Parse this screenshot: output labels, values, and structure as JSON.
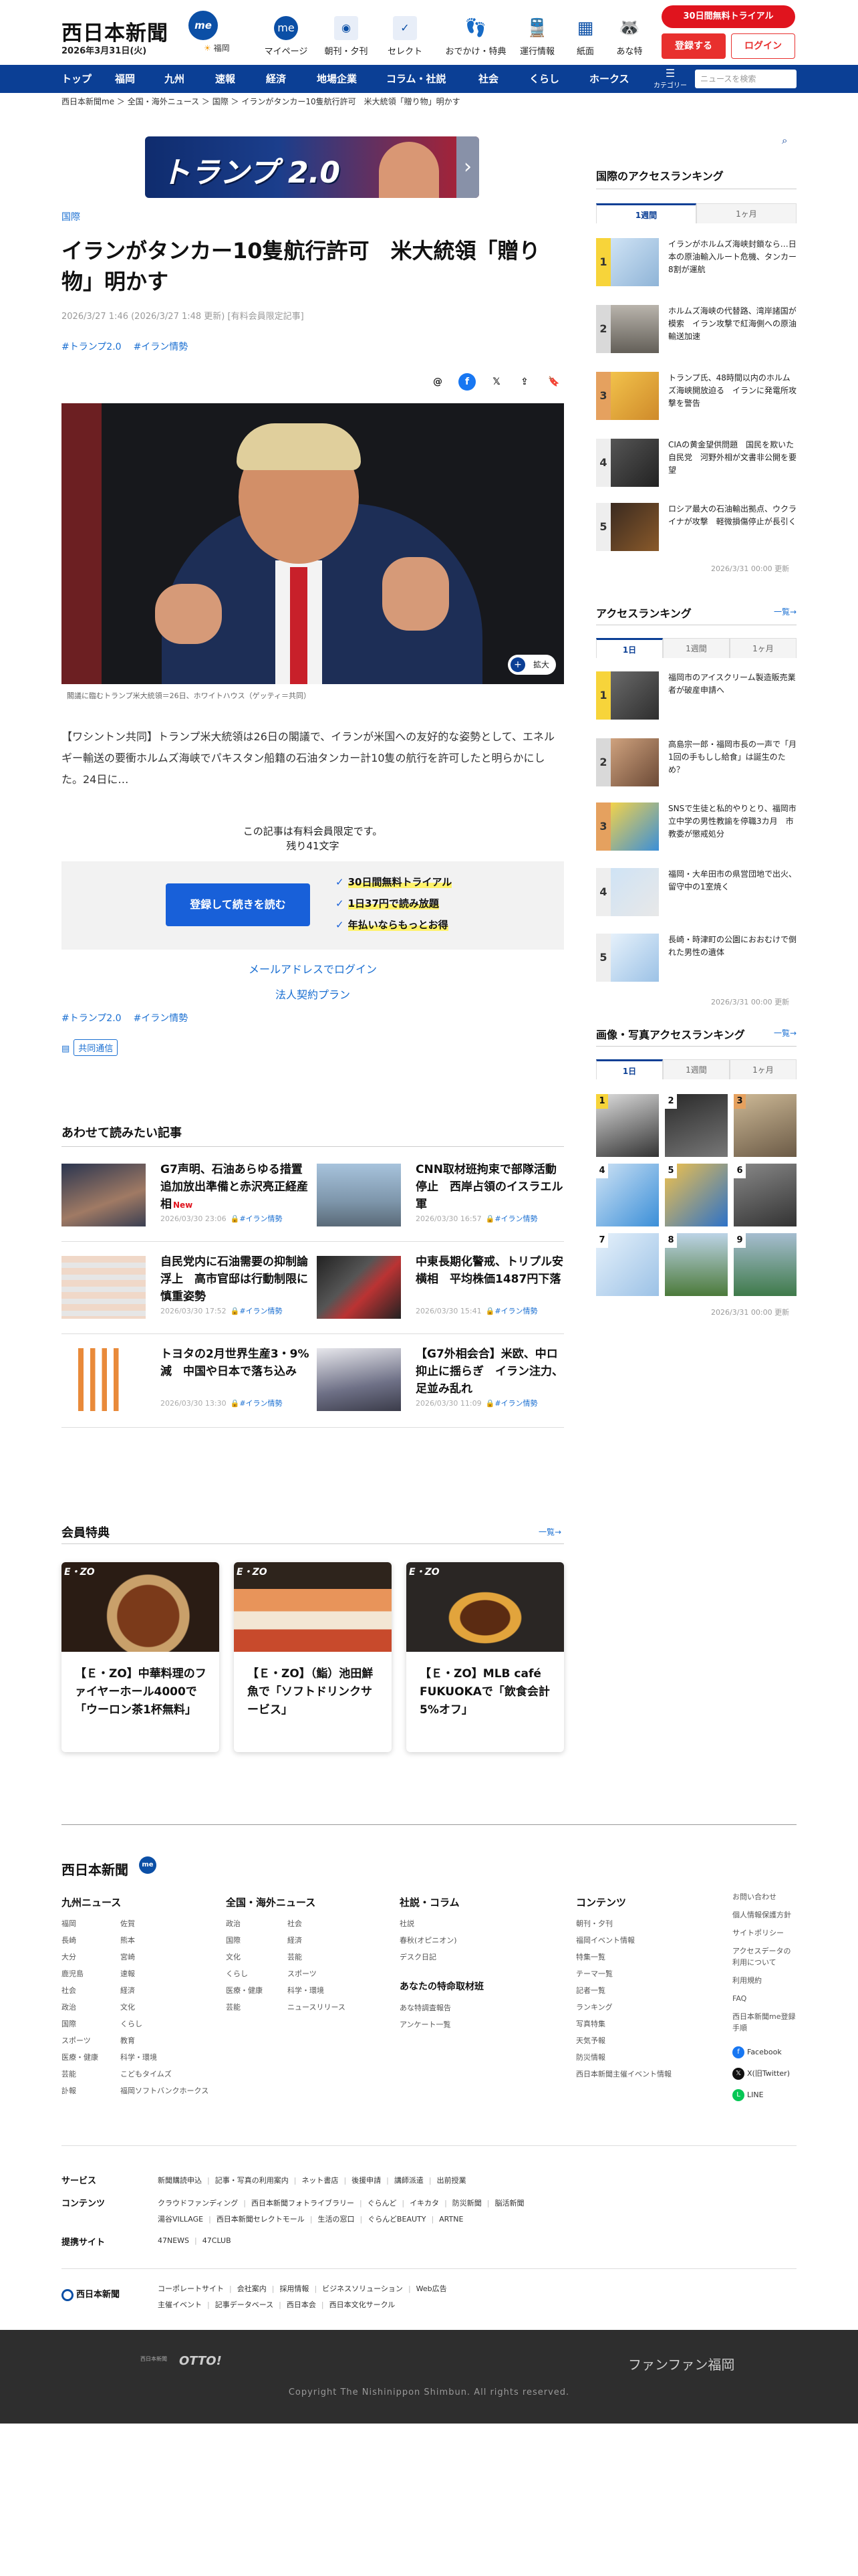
{
  "header": {
    "logo": "西日本新聞",
    "logo_badge": "me",
    "date": "2026年3月31日(火)",
    "weather": "福岡",
    "nav": [
      {
        "label": "マイページ",
        "icon": "mypage-icon",
        "glyph": "me"
      },
      {
        "label": "朝刊・夕刊",
        "icon": "newspaper-icon",
        "glyph": "◉"
      },
      {
        "label": "セレクト",
        "icon": "select-icon",
        "glyph": "✓"
      },
      {
        "label": "おでかけ・特典",
        "icon": "footprints-icon",
        "glyph": "👣"
      },
      {
        "label": "運行情報",
        "icon": "train-icon",
        "glyph": "🚆"
      },
      {
        "label": "紙面",
        "icon": "paper-icon",
        "glyph": "▦"
      },
      {
        "label": "あな特",
        "icon": "raccoon-icon",
        "glyph": "🦝"
      }
    ],
    "trial": "30日間無料トライアル",
    "register": "登録する",
    "login": "ログイン"
  },
  "navbar": {
    "items": [
      "トップ",
      "福岡",
      "九州",
      "速報",
      "経済",
      "地場企業",
      "コラム・社説",
      "社会",
      "くらし",
      "ホークス"
    ],
    "menu_label": "カテゴリー",
    "search_placeholder": "ニュースを検索"
  },
  "breadcrumb": "西日本新聞me ＞ 全国・海外ニュース ＞ 国際 ＞ イランがタンカー10隻航行許可　米大統領「贈り物」明かす",
  "banner": {
    "title": "トランプ 2.0",
    "arrow": "›"
  },
  "article": {
    "section": "国際",
    "headline": "イランがタンカー10隻航行許可　米大統領「贈り物」明かす",
    "date": "2026/3/27 1:46 (2026/3/27 1:48 更新) [有料会員限定記事]",
    "tags": [
      "#トランプ2.0",
      "#イラン情勢"
    ],
    "photo_caption": "閣議に臨むトランプ米大統領＝26日、ホワイトハウス（ゲッティ＝共同）",
    "zoom": "拡大",
    "lead": "【ワシントン共同】トランプ米大統領は26日の閣議で、イランが米国への友好的な姿勢として、エネルギー輸送の要衝ホルムズ海峡でパキスタン船籍の石油タンカー計10隻の航行を許可したと明らかにした。24日に…",
    "paywall_msg": "この記事は有料会員限定です。",
    "remaining": "残り41文字",
    "pw_button": "登録して続きを読む",
    "pw_points": [
      "30日間無料トライアル",
      "1日37円で読み放題",
      "年払いならもっとお得"
    ],
    "mail_login": "メールアドレスでログイン",
    "corp_plan": "法人契約プラン",
    "source_prefix": "▤",
    "source": "共同通信"
  },
  "related": {
    "title": "あわせて読みたい記事",
    "items": [
      {
        "title": "G7声明、石油あらゆる措置　追加放出準備と赤沢亮正経産相",
        "new": "New",
        "date": "2026/03/30 23:06",
        "tag": "#イラン情勢"
      },
      {
        "title": "CNN取材班拘束で部隊活動停止　西岸占領のイスラエル軍",
        "new": "",
        "date": "2026/03/30 16:57",
        "tag": "#イラン情勢"
      },
      {
        "title": "自民党内に石油需要の抑制論浮上　高市官邸は行動制限に慎重姿勢",
        "new": "",
        "date": "2026/03/30 17:52",
        "tag": "#イラン情勢"
      },
      {
        "title": "中東長期化警戒、トリプル安横相　平均株価1487円下落",
        "new": "",
        "date": "2026/03/30 15:41",
        "tag": "#イラン情勢"
      },
      {
        "title": "トヨタの2月世界生産3・9%減　中国や日本で落ち込み",
        "new": "",
        "date": "2026/03/30 13:30",
        "tag": "#イラン情勢"
      },
      {
        "title": "【G7外相会合】米欧、中ロ抑止に揺らぎ　イラン注力、足並み乱れ",
        "new": "",
        "date": "2026/03/30 11:09",
        "tag": "#イラン情勢"
      }
    ]
  },
  "benefits": {
    "title": "会員特典",
    "more": "一覧",
    "items": [
      {
        "brand": "E・ZO",
        "title": "【Ｅ・ZO】中華料理のファイヤーホール4000で「ウーロン茶1杯無料」"
      },
      {
        "brand": "E・ZO",
        "title": "【Ｅ・ZO】（鮨）池田鮮魚で「ソフトドリンクサービス」"
      },
      {
        "brand": "E・ZO",
        "title": "【Ｅ・ZO】MLB café FUKUOKAで「飲食会計5%オフ」"
      }
    ]
  },
  "right": {
    "intl_title": "国際のアクセスランキング",
    "intl_tabs": [
      "1週間",
      "1ヶ月"
    ],
    "intl_items": [
      "イランがホルムズ海峡封鎖なら…日本の原油輸入ルート危機、タンカー8割が運航",
      "ホルムズ海峡の代替路、湾岸諸国が模索　イラン攻撃で紅海側への原油輸送加速",
      "トランプ氏、48時間以内のホルムズ海峡開放迫る　イランに発電所攻撃を警告",
      "CIAの黄金望供問題　国民を欺いた自民党　河野外相が文書非公開を要望",
      "ロシア最大の石油輸出拠点、ウクライナが攻撃　軽微損傷停止が長引く"
    ],
    "intl_updated": "2026/3/31 00:00 更新",
    "access_title": "アクセスランキング",
    "access_more": "一覧",
    "access_tabs": [
      "1日",
      "1週間",
      "1ヶ月"
    ],
    "access_items": [
      "福岡市のアイスクリーム製造販売業者が破産申請へ",
      "高島宗一郎・福岡市長の一声で「月1回の手もしし給食」は誕生のため？",
      "SNSで生徒と私的やりとり、福岡市立中学の男性教諭を停職3カ月　市教委が懲戒処分",
      "福岡・大牟田市の県営団地で出火、留守中の1室焼く",
      "長崎・時津町の公園におおむけで倒れた男性の遺体"
    ],
    "access_updated": "2026/3/31 00:00 更新",
    "gallery_title": "画像・写真アクセスランキング",
    "gallery_more": "一覧",
    "gallery_tabs": [
      "1日",
      "1週間",
      "1ヶ月"
    ],
    "gallery_nums": [
      "1",
      "2",
      "3",
      "4",
      "5",
      "6",
      "7",
      "8",
      "9"
    ],
    "gallery_updated": "2026/3/31 00:00 更新"
  },
  "footer": {
    "logo": "西日本新聞",
    "logo_badge": "me",
    "col1_title": "九州ニュース",
    "col1a": [
      "福岡",
      "長崎",
      "大分",
      "鹿児島",
      "社会",
      "政治",
      "国際",
      "スポーツ",
      "医療・健康",
      "芸能",
      "訃報"
    ],
    "col1b": [
      "佐賀",
      "熊本",
      "宮崎",
      "速報",
      "経済",
      "文化",
      "くらし",
      "教育",
      "科学・環境",
      "こどもタイムズ",
      "福岡ソフトバンクホークス"
    ],
    "col2_title": "全国・海外ニュース",
    "col2a": [
      "政治",
      "国際",
      "文化",
      "くらし",
      "医療・健康",
      "芸能"
    ],
    "col2b": [
      "社会",
      "経済",
      "芸能",
      "スポーツ",
      "科学・環境",
      "ニュースリリース"
    ],
    "col3_title": "社説・コラム",
    "col3a": [
      "社説",
      "春秋(オピニオン)",
      "デスク日記"
    ],
    "col3_sub": "あなたの特命取材班",
    "col3b": [
      "あな特調査報告",
      "アンケート一覧"
    ],
    "col4_title": "コンテンツ",
    "col4a": [
      "朝刊・夕刊",
      "福岡イベント情報",
      "特集一覧",
      "テーマ一覧",
      "記者一覧",
      "ランキング",
      "写真特集",
      "天気予報",
      "防災情報",
      "西日本新聞主催イベント情報"
    ],
    "col5": [
      "お問い合わせ",
      "個人情報保護方針",
      "サイトポリシー",
      "アクセスデータの利用について",
      "利用規約",
      "FAQ",
      "西日本新聞me登録手順"
    ],
    "sns": [
      "Facebook",
      "X(旧Twitter)",
      "LINE"
    ],
    "rows": [
      {
        "label": "サービス",
        "items": [
          "新聞購読申込",
          "記事・写真の利用案内",
          "ネット書店",
          "後援申請",
          "講師派遣",
          "出前授業"
        ]
      },
      {
        "label": "コンテンツ",
        "items": [
          "クラウドファンディング",
          "西日本新聞フォトライブラリー",
          "ぐらんど",
          "イキカタ",
          "防災新聞",
          "脳活新聞"
        ]
      },
      {
        "label": "",
        "items": [
          "湯谷VILLAGE",
          "西日本新聞セレクトモール",
          "生活の窓口",
          "ぐらんどBEAUTY",
          "ARTNE"
        ]
      },
      {
        "label": "提携サイト",
        "items": [
          "47NEWS",
          "47CLUB"
        ]
      }
    ],
    "corp_logo": "西日本新聞",
    "corp_links1": [
      "コーポレートサイト",
      "会社案内",
      "採用情報",
      "ビジネスソリューション",
      "Web広告"
    ],
    "corp_links2": [
      "主催イベント",
      "記事データベース",
      "西日本会",
      "西日本文化サークル"
    ],
    "otto_sub": "西日本新聞",
    "otto": "OTTO!",
    "funfun": "ファンファン福岡",
    "copyright": "Copyright The Nishinippon Shimbun. All rights reserved."
  },
  "colors": {
    "brand": "#0b3f95",
    "accent": "#e0141e",
    "link": "#1a6fd2"
  }
}
